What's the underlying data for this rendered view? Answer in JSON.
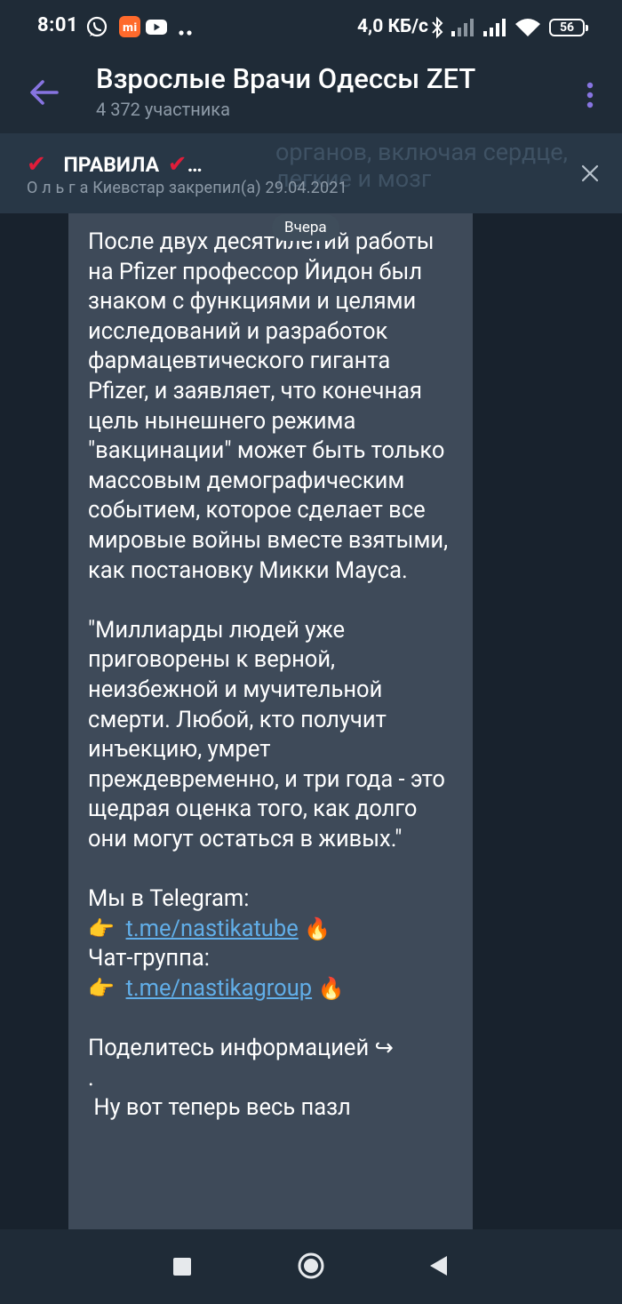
{
  "status_bar": {
    "time": "8:01",
    "netspeed": "4,0 КБ/с",
    "battery": "56",
    "icons": [
      "viber-icon",
      "mi-icon",
      "youtube-icon",
      "more-dots-icon",
      "bluetooth-icon",
      "signal-icon",
      "signal-icon",
      "wifi-icon",
      "battery-icon"
    ]
  },
  "header": {
    "title": "Взрослые Врачи Одессы ZET",
    "subtitle": "4 372 участника"
  },
  "pinned": {
    "title": "ПРАВИЛА",
    "title_prefix": "✔",
    "title_suffix": "✔…",
    "meta": "О л ь г а Киевстар закрепил(а) 29.04.2021",
    "ghost_line1": "органов, включая сердце,",
    "ghost_line2": "легкие и мозг"
  },
  "date_chip": "Вчера",
  "message": {
    "paragraph1": "После двух десятилетий работы на Pfizer профессор Йидон был знаком с функциями и целями исследований и разработок фармацевтического гиганта Pfizer, и заявляет, что конечная цель нынешнего режима \"вакцинации\" может быть только массовым демографическим событием, которое сделает все мировые войны вместе взятыми, как постановку Микки Мауса.",
    "paragraph2": "\"Миллиарды людей уже приговорены к верной, неизбежной и мучительной смерти. Любой, кто получит инъекцию, умрет преждевременно, и три года - это щедрая оценка того, как долго они могут остаться в живых.\"",
    "telegram_label": "Мы в Telegram:",
    "pointer_emoji": "👉",
    "fire_emoji": "🔥",
    "link1": "t.me/nastikatube",
    "chat_label": "Чат-группа:",
    "link2": "t.me/nastikagroup",
    "share_label": "Поделитесь информацией ↪",
    "share_dot": ".",
    "last_line": " Ну вот теперь весь пазл"
  },
  "colors": {
    "background": "#18222d",
    "header": "#1f2b37",
    "bubble": "#3e4a59",
    "link": "#61aee8",
    "accent": "#8774e1",
    "subtitle": "#8d9aa7"
  }
}
